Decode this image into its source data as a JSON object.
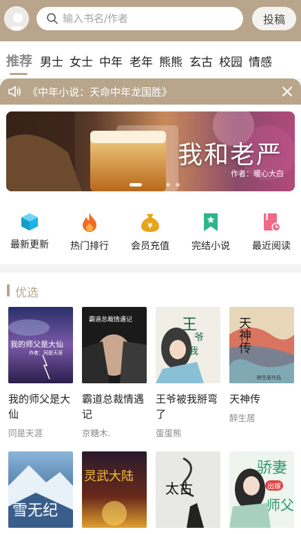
{
  "header": {
    "search_placeholder": "输入书名/作者",
    "submit_label": "投稿"
  },
  "tabs": [
    {
      "label": "推荐",
      "active": true
    },
    {
      "label": "男士"
    },
    {
      "label": "女士"
    },
    {
      "label": "中年"
    },
    {
      "label": "老年"
    },
    {
      "label": "熊熊"
    },
    {
      "label": "玄古"
    },
    {
      "label": "校园"
    },
    {
      "label": "情感"
    }
  ],
  "notice": {
    "text": "《中年小说：天命中年龙国胜》"
  },
  "banner": {
    "title": "我和老严",
    "author": "作者：暖心大白"
  },
  "menu": [
    {
      "label": "最新更新",
      "icon": "cube-icon",
      "color": "#1bb3e6"
    },
    {
      "label": "热门排行",
      "icon": "flame-icon",
      "color": "#f26b2a"
    },
    {
      "label": "会员充值",
      "icon": "money-bag-icon",
      "color": "#e8a41c"
    },
    {
      "label": "完结小说",
      "icon": "bookmark-icon",
      "color": "#2fb58c"
    },
    {
      "label": "最近阅读",
      "icon": "book-clock-icon",
      "color": "#ef6a86"
    }
  ],
  "section": {
    "title": "优选"
  },
  "books": [
    {
      "title": "我的师父是大仙",
      "author": "同是天涯",
      "cover_text": "我的师父是大仙",
      "cover_sub": "作者：同是天涯"
    },
    {
      "title": "霸道总裁情遇记",
      "author": "京糖木.",
      "cover_text": "霸道总裁情遇记"
    },
    {
      "title": "王爷被我掰弯了",
      "author": "蛋蛋熊",
      "cover_text": "王爷被我掰弯了"
    },
    {
      "title": "天神传",
      "author": "醉生居",
      "cover_text": "天神传",
      "cover_sub": "醉生居作品"
    },
    {
      "title": "雪无纪",
      "cover_text": "雪无纪"
    },
    {
      "title": "灵武大陆",
      "cover_text": "灵武大陆"
    },
    {
      "title": "太古",
      "cover_text": "太古"
    },
    {
      "title": "骄妻出嫁师父",
      "cover_text": "骄妻",
      "cover_sub": "出嫁",
      "cover_sub2": "师父"
    }
  ]
}
